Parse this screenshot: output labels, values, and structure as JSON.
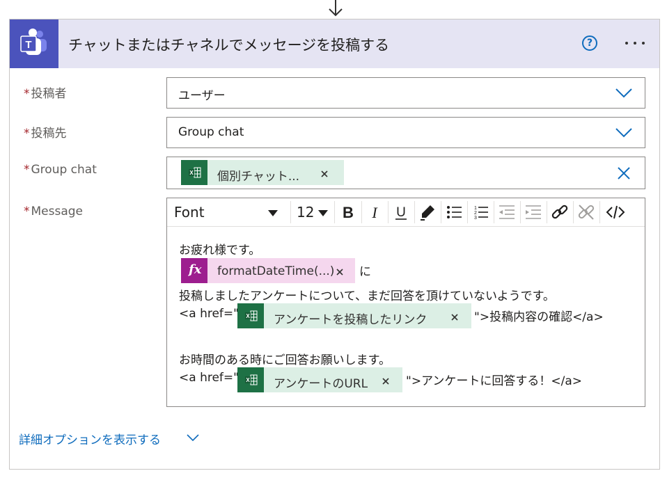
{
  "action": {
    "title": "チャットまたはチャネルでメッセージを投稿する",
    "help_label": "?"
  },
  "fields": {
    "poster": {
      "label": "投稿者",
      "value": "ユーザー"
    },
    "post_in": {
      "label": "投稿先",
      "value": "Group chat"
    },
    "group_chat": {
      "label": "Group chat",
      "token": "個別チャット..."
    },
    "message": {
      "label": "Message"
    }
  },
  "required_marker": "*",
  "editor": {
    "font_name": "Font",
    "font_size": "12",
    "toolbar_buttons": [
      "bold",
      "italic",
      "underline",
      "highlight",
      "bulleted-list",
      "numbered-list",
      "decrease-indent",
      "increase-indent",
      "link",
      "unlink",
      "code-view"
    ]
  },
  "message_body": {
    "line1": "お疲れ様です。",
    "fx_token": "formatDateTime(...)",
    "fx_suffix": "に",
    "line3": "投稿しましたアンケートについて、まだ回答を頂けていないようです。",
    "line4_prefix": "<a href=\"",
    "line4_token": "アンケートを投稿したリンク",
    "line4_suffix": "\">投稿内容の確認</a>",
    "line5": "お時間のある時にご回答お願いします。",
    "line6_prefix": "<a href=\"",
    "line6_token": "アンケートのURL",
    "line6_suffix": "\">アンケートに回答する！</a>"
  },
  "advanced_options_label": "詳細オプションを表示する",
  "colors": {
    "header_bg": "#e5e4f3",
    "teams_brand": "#4b53bc",
    "excel_green": "#1e7145",
    "excel_token_bg": "#dcefe5",
    "fx_magenta": "#9d1e8f",
    "fx_token_bg": "#f5d7ee",
    "link_blue": "#0f6cbd",
    "required_red": "#a4262c"
  }
}
